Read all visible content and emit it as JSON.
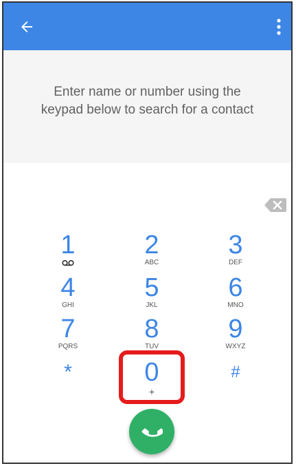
{
  "appbar": {
    "back_icon": "arrow-back-icon",
    "more_icon": "more-vertical-icon",
    "color": "#3d86e5"
  },
  "hint": {
    "text": "Enter name or number using the keypad below to search for a contact"
  },
  "keypad": {
    "backspace_icon": "backspace-icon",
    "keys": [
      {
        "digit": "1",
        "letters": "",
        "icon": "voicemail-icon"
      },
      {
        "digit": "2",
        "letters": "ABC"
      },
      {
        "digit": "3",
        "letters": "DEF"
      },
      {
        "digit": "4",
        "letters": "GHI"
      },
      {
        "digit": "5",
        "letters": "JKL"
      },
      {
        "digit": "6",
        "letters": "MNO"
      },
      {
        "digit": "7",
        "letters": "PQRS"
      },
      {
        "digit": "8",
        "letters": "TUV"
      },
      {
        "digit": "9",
        "letters": "WXYZ"
      },
      {
        "digit": "*",
        "letters": ""
      },
      {
        "digit": "0",
        "letters": "+"
      },
      {
        "digit": "#",
        "letters": ""
      }
    ],
    "highlighted_key": "0",
    "highlight_color": "#e51c1c"
  },
  "call": {
    "icon": "phone-icon",
    "color": "#2fb066"
  }
}
